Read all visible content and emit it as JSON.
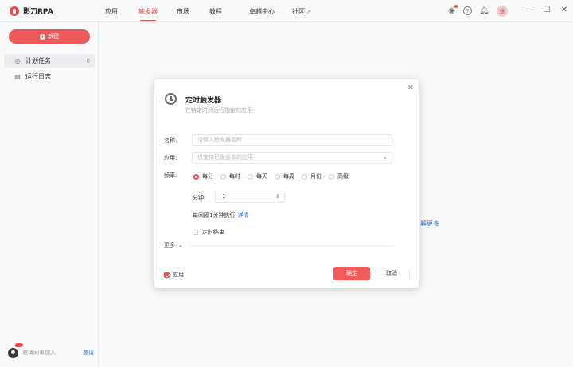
{
  "app": {
    "name": "影刀RPA"
  },
  "nav": {
    "items": [
      {
        "label": "应用"
      },
      {
        "label": "触发器"
      },
      {
        "label": "市场"
      },
      {
        "label": "教程"
      },
      {
        "label": "卓越中心"
      },
      {
        "label": "社区"
      }
    ],
    "active": "触发器"
  },
  "header": {
    "avatar_text": "张"
  },
  "sidebar": {
    "new_button": "新建",
    "items": [
      {
        "label": "计划任务",
        "count": "0"
      },
      {
        "label": "运行日志"
      }
    ],
    "invite_text": "邀请同事加入",
    "invite_link": "邀请"
  },
  "main": {
    "learn_more": "解更多"
  },
  "dialog": {
    "title": "定时触发器",
    "subtitle": "在特定时间运行指定的应用",
    "name_label": "名称:",
    "name_placeholder": "请输入触发器名称",
    "app_label": "应用:",
    "app_placeholder": "仅支持已发版本的应用",
    "freq_label": "频率:",
    "freq_options": [
      "每分",
      "每时",
      "每天",
      "每周",
      "月份",
      "高级"
    ],
    "freq_selected": "每分",
    "minute_label": "分钟:",
    "minute_value": "1",
    "interval_text": "每间隔1分钟执行",
    "detail_link": "详情",
    "end_time_label": "定时结束",
    "more_label": "更多",
    "apply_label": "应用",
    "ok_button": "确定",
    "cancel_button": "取消"
  },
  "colors": {
    "accent": "#f04d4d",
    "link": "#2f6fd6"
  }
}
